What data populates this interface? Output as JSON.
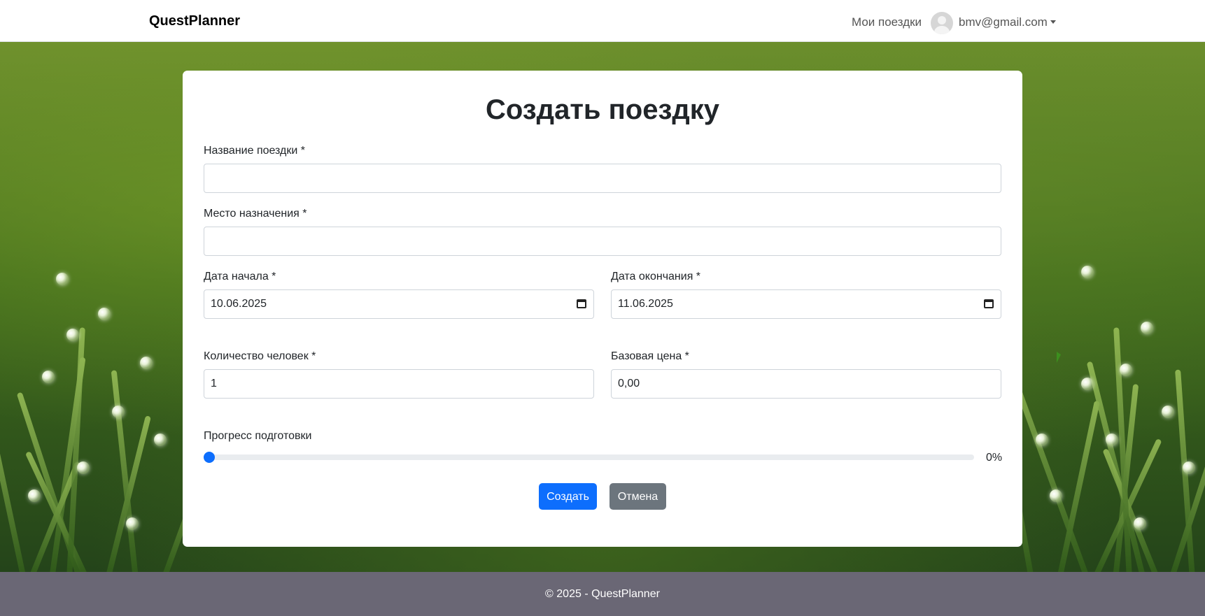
{
  "navbar": {
    "brand": "QuestPlanner",
    "my_trips": "Мои поездки",
    "user_email": "bmv@gmail.com"
  },
  "form": {
    "title": "Создать поездку",
    "trip_name_label": "Название поездки *",
    "trip_name_value": "",
    "destination_label": "Место назначения *",
    "destination_value": "",
    "start_date_label": "Дата начала *",
    "start_date_value": "10.06.2025",
    "end_date_label": "Дата окончания *",
    "end_date_value": "11.06.2025",
    "people_label": "Количество человек *",
    "people_value": "1",
    "price_label": "Базовая цена *",
    "price_value": "0,00",
    "progress_label": "Прогресс подготовки",
    "progress_value": 0,
    "progress_text": "0%",
    "create_button": "Создать",
    "cancel_button": "Отмена"
  },
  "footer": {
    "text": "© 2025 - QuestPlanner"
  },
  "colors": {
    "primary": "#0d6efd",
    "secondary": "#6c757d",
    "footer_bg": "#6a6775"
  }
}
